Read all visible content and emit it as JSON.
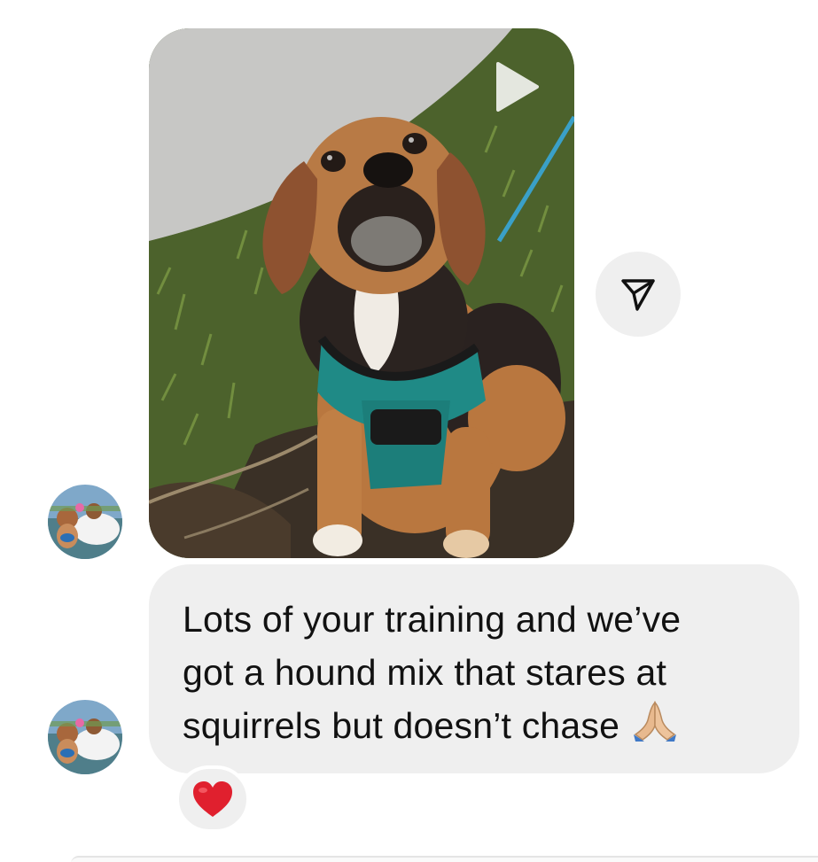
{
  "thread": {
    "video_message": {
      "media": "dog-in-harness-video-thumbnail",
      "play_icon": "play-icon"
    },
    "share_button": {
      "icon": "paper-plane-icon"
    },
    "text_message": {
      "line1": "Lots of your training and we’ve",
      "line2": "got a hound mix that stares at",
      "line3": "squirrels but doesn’t chase",
      "emoji": "folded-hands-emoji"
    },
    "reaction": {
      "icon": "red-heart-emoji",
      "color": "#e0202e"
    }
  },
  "colors": {
    "bubble": "#efefef",
    "text": "#111111",
    "background": "#ffffff"
  }
}
